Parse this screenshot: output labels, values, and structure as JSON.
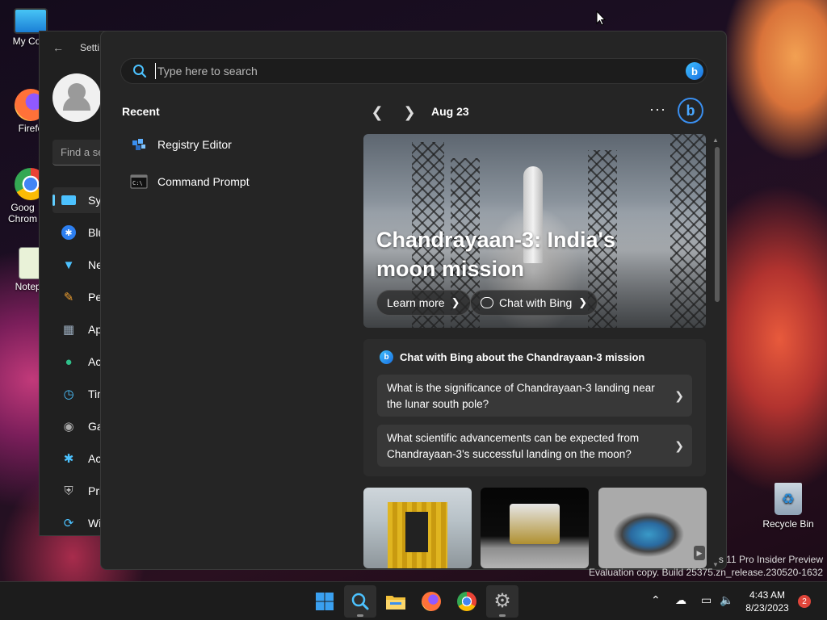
{
  "desktop": {
    "icons": [
      {
        "name": "this-pc",
        "label": "My Com"
      },
      {
        "name": "firefox",
        "label": "Firefo"
      },
      {
        "name": "chrome",
        "label": "Goog Chrom"
      },
      {
        "name": "notepad",
        "label": "Notepa"
      }
    ],
    "recycle_bin": "Recycle Bin",
    "watermark_line1": "s 11 Pro Insider Preview",
    "watermark_line2": "Evaluation copy. Build 25375.zn_release.230520-1632"
  },
  "settings": {
    "title": "Setti",
    "find_placeholder": "Find a se",
    "nav": [
      {
        "name": "system",
        "label": "Sys",
        "icon": "monitor-icon"
      },
      {
        "name": "bluetooth",
        "label": "Blu",
        "icon": "bluetooth-icon"
      },
      {
        "name": "network",
        "label": "Ne",
        "icon": "wifi-icon"
      },
      {
        "name": "personalization",
        "label": "Per",
        "icon": "brush-icon"
      },
      {
        "name": "apps",
        "label": "Ap",
        "icon": "apps-icon"
      },
      {
        "name": "accounts",
        "label": "Ac",
        "icon": "person-icon"
      },
      {
        "name": "time",
        "label": "Tin",
        "icon": "clock-globe-icon"
      },
      {
        "name": "gaming",
        "label": "Ga",
        "icon": "gamepad-icon"
      },
      {
        "name": "accessibility",
        "label": "Ac",
        "icon": "accessibility-icon"
      },
      {
        "name": "privacy",
        "label": "Pri",
        "icon": "shield-icon"
      },
      {
        "name": "windows-update",
        "label": "Wi",
        "icon": "update-icon"
      }
    ]
  },
  "search": {
    "placeholder": "Type here to search",
    "recent_heading": "Recent",
    "recent": [
      {
        "label": "Registry Editor",
        "icon": "registry-editor-icon"
      },
      {
        "label": "Command Prompt",
        "icon": "command-prompt-icon"
      }
    ],
    "date": "Aug 23",
    "more": "···",
    "hero": {
      "title": "Chandrayaan-3: India's moon mission",
      "learn_more": "Learn more",
      "chat_with_bing": "Chat with Bing"
    },
    "chat": {
      "heading": "Chat with Bing about the Chandrayaan-3 mission",
      "questions": [
        "What is the significance of Chandrayaan-3 landing near the lunar south pole?",
        "What scientific advancements can be expected from Chandrayaan-3's successful landing on the moon?"
      ]
    }
  },
  "taskbar": {
    "clock_time": "4:43 AM",
    "clock_date": "8/23/2023",
    "notification_count": "2"
  },
  "colors": {
    "accent": "#60cdff",
    "bing_blue": "#1a6fe0",
    "panel_bg": "#252525",
    "taskbar_bg": "#1c1c1c"
  }
}
